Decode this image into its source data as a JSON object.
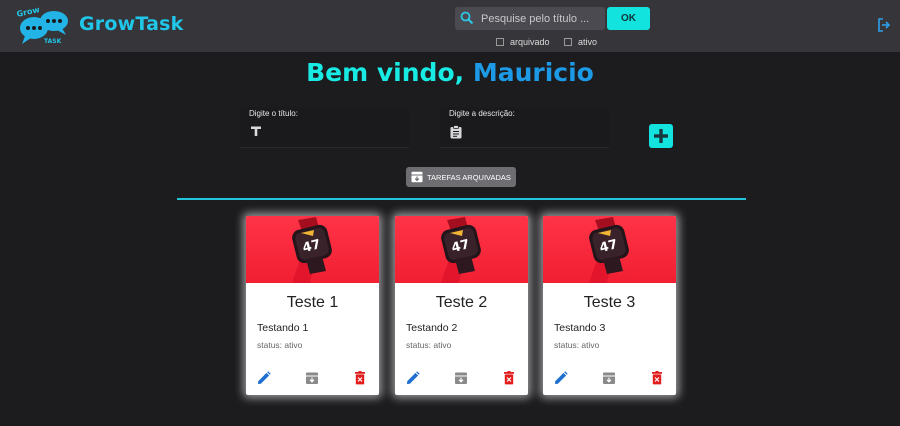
{
  "header": {
    "logo_text": [
      "Grow",
      "TASK"
    ],
    "brand": "GrowTask",
    "search": {
      "placeholder": "Pesquise pelo título ...",
      "value": ""
    },
    "ok_label": "OK",
    "filters": [
      {
        "label": "arquivado",
        "checked": false
      },
      {
        "label": "ativo",
        "checked": false
      }
    ],
    "logout_icon": "logout-icon"
  },
  "welcome": {
    "greeting": "Bem vindo,",
    "name": "Mauricio"
  },
  "form": {
    "title_label": "Digite o título:",
    "title_value": "",
    "description_label": "Digite a descrição:",
    "description_value": "",
    "add_icon": "plus-icon"
  },
  "archived_button": {
    "label": "TAREFAS ARQUIVADAS",
    "icon": "archive-icon"
  },
  "tasks": [
    {
      "title": "Teste 1",
      "description": "Testando 1",
      "status": "status: ativo",
      "badge": "47"
    },
    {
      "title": "Teste 2",
      "description": "Testando 2",
      "status": "status: ativo",
      "badge": "47"
    },
    {
      "title": "Teste 3",
      "description": "Testando 3",
      "status": "status: ativo",
      "badge": "47"
    }
  ],
  "colors": {
    "accent": "#12e3df",
    "brand": "#20c7e8",
    "name": "#1c9ae6",
    "edit": "#1e6fd0",
    "archive": "#8a8a8a",
    "delete": "#e21d1d",
    "card_image": "#f21f32"
  }
}
